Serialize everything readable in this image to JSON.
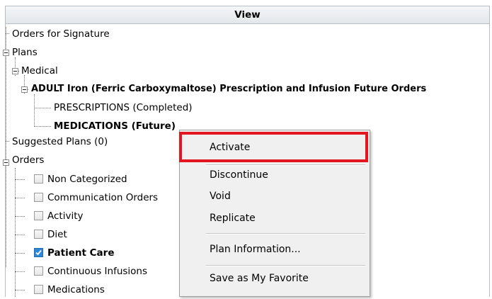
{
  "header": {
    "title": "View"
  },
  "tree": {
    "orders_for_signature": "Orders for Signature",
    "plans": "Plans",
    "medical": "Medical",
    "plan_name": "ADULT Iron (Ferric Carboxymaltose) Prescription and Infusion Future Orders",
    "prescriptions": "PRESCRIPTIONS (Completed)",
    "medications_future": "MEDICATIONS (Future)",
    "suggested_plans": "Suggested Plans (0)",
    "orders": "Orders",
    "categories": [
      {
        "label": "Non Categorized",
        "checked": false
      },
      {
        "label": "Communication Orders",
        "checked": false
      },
      {
        "label": "Activity",
        "checked": false
      },
      {
        "label": "Diet",
        "checked": false
      },
      {
        "label": "Patient Care",
        "checked": true
      },
      {
        "label": "Continuous Infusions",
        "checked": false
      },
      {
        "label": "Medications",
        "checked": false
      }
    ]
  },
  "context_menu": {
    "items": [
      "Activate",
      "Discontinue",
      "Void",
      "Replicate",
      "Plan Information...",
      "Save as My Favorite"
    ],
    "highlighted": "Activate",
    "highlight_color": "#e3161f"
  },
  "colors": {
    "checkbox_checked": "#2f86d6"
  }
}
